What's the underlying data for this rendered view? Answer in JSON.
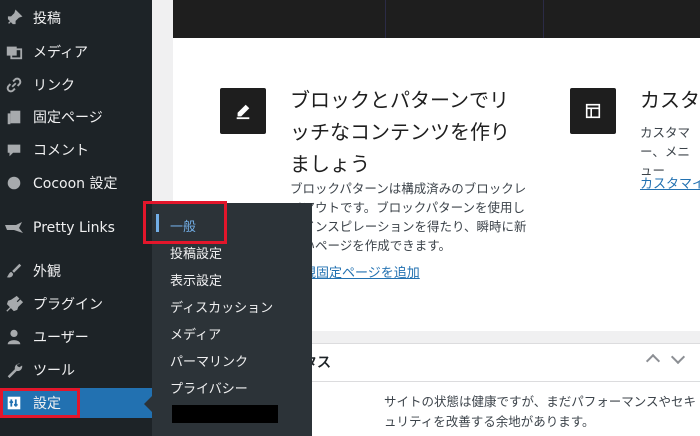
{
  "sidebar": {
    "items": [
      {
        "label": "投稿",
        "icon": "pin-icon"
      },
      {
        "label": "メディア",
        "icon": "media-icon"
      },
      {
        "label": "リンク",
        "icon": "link-icon"
      },
      {
        "label": "固定ページ",
        "icon": "page-icon"
      },
      {
        "label": "コメント",
        "icon": "comment-icon"
      },
      {
        "label": "Cocoon 設定",
        "icon": "cocoon-icon"
      },
      {
        "label": "Pretty Links",
        "icon": "star-icon"
      },
      {
        "label": "外観",
        "icon": "brush-icon"
      },
      {
        "label": "プラグイン",
        "icon": "plugin-icon"
      },
      {
        "label": "ユーザー",
        "icon": "user-icon"
      },
      {
        "label": "ツール",
        "icon": "wrench-icon"
      },
      {
        "label": "設定",
        "icon": "settings-icon"
      }
    ]
  },
  "submenu": {
    "items": [
      "一般",
      "投稿設定",
      "表示設定",
      "ディスカッション",
      "メディア",
      "パーマリンク",
      "プライバシー"
    ]
  },
  "main": {
    "feature1": {
      "title": "ブロックとパターンでリッチなコンテンツを作りましょう",
      "description": "ブロックパターンは構成済みのブロックレイアウトです。ブロックパターンを使用してインスピレーションを得たり、瞬時に新しいページを作成できます。",
      "link": "新規固定ページを追加"
    },
    "feature2": {
      "title": "カスタ",
      "description": "カスタマー、メニュー",
      "link": "カスタマイ"
    },
    "health": {
      "title": "タス",
      "text": "サイトの状態は健康ですが、まだパフォーマンスやセキュリティを改善する余地があります。"
    }
  },
  "colors": {
    "sidebar_bg": "#1d2327",
    "submenu_bg": "#2c3338",
    "accent": "#2271b1",
    "highlight_outline": "#e3162b"
  }
}
